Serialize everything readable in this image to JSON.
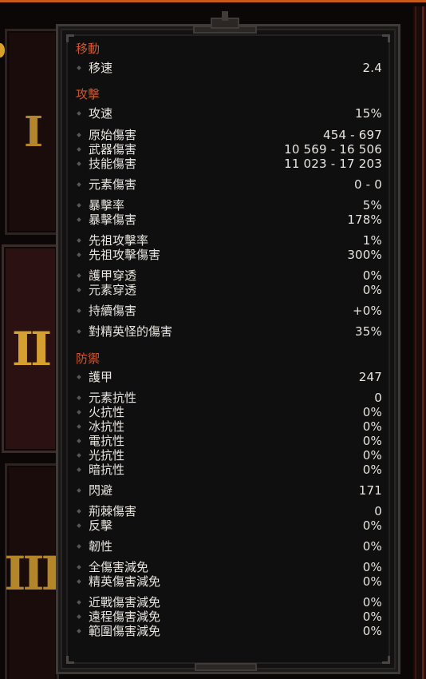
{
  "tabs": [
    {
      "label": "I"
    },
    {
      "label": "II"
    },
    {
      "label": "III"
    }
  ],
  "sections": {
    "movement": {
      "title": "移動",
      "rows": [
        {
          "label": "移速",
          "value": "2.4"
        }
      ]
    },
    "attack": {
      "title": "攻擊",
      "rows": [
        {
          "label": "攻速",
          "value": "15%"
        },
        {
          "label": "原始傷害",
          "value": "454 - 697"
        },
        {
          "label": "武器傷害",
          "value": "10 569 - 16 506"
        },
        {
          "label": "技能傷害",
          "value": "11 023 - 17 203"
        },
        {
          "label": "元素傷害",
          "value": "0 - 0"
        },
        {
          "label": "暴擊率",
          "value": "5%"
        },
        {
          "label": "暴擊傷害",
          "value": "178%"
        },
        {
          "label": "先祖攻擊率",
          "value": "1%"
        },
        {
          "label": "先祖攻擊傷害",
          "value": "300%"
        },
        {
          "label": "護甲穿透",
          "value": "0%"
        },
        {
          "label": "元素穿透",
          "value": "0%"
        },
        {
          "label": "持續傷害",
          "value": "+0%"
        },
        {
          "label": "對精英怪的傷害",
          "value": "35%"
        }
      ]
    },
    "defense": {
      "title": "防禦",
      "rows": [
        {
          "label": "護甲",
          "value": "247"
        },
        {
          "label": "元素抗性",
          "value": "0"
        },
        {
          "label": "火抗性",
          "value": "0%"
        },
        {
          "label": "冰抗性",
          "value": "0%"
        },
        {
          "label": "電抗性",
          "value": "0%"
        },
        {
          "label": "光抗性",
          "value": "0%"
        },
        {
          "label": "暗抗性",
          "value": "0%"
        },
        {
          "label": "閃避",
          "value": "171"
        },
        {
          "label": "荊棘傷害",
          "value": "0"
        },
        {
          "label": "反擊",
          "value": "0%"
        },
        {
          "label": "韌性",
          "value": "0%"
        },
        {
          "label": "全傷害減免",
          "value": "0%"
        },
        {
          "label": "精英傷害減免",
          "value": "0%"
        },
        {
          "label": "近戰傷害減免",
          "value": "0%"
        },
        {
          "label": "遠程傷害減免",
          "value": "0%"
        },
        {
          "label": "範圍傷害減免",
          "value": "0%"
        }
      ]
    }
  },
  "colors": {
    "section_title": "#d0572b",
    "text": "#e8e4df",
    "tab_numeral": "#d6a030",
    "accent_top": "#c85a1c"
  }
}
